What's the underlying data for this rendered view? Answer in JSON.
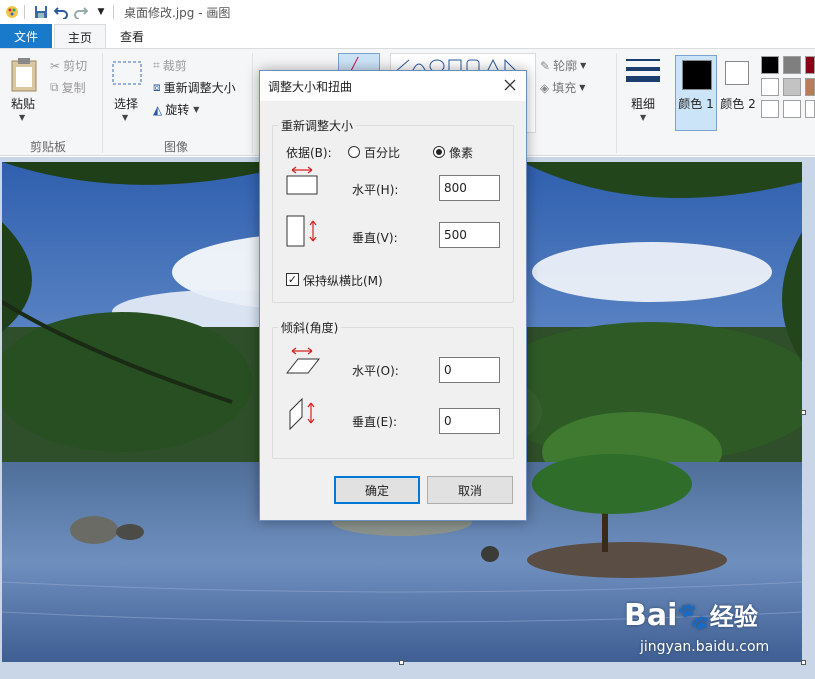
{
  "window": {
    "title": "桌面修改.jpg - 画图"
  },
  "tabs": {
    "file": "文件",
    "home": "主页",
    "view": "查看"
  },
  "ribbon": {
    "clipboard": {
      "paste": "粘贴",
      "cut": "剪切",
      "copy": "复制",
      "group": "剪贴板"
    },
    "image": {
      "select": "选择",
      "crop": "裁剪",
      "resize": "重新调整大小",
      "rotate": "旋转",
      "group": "图像"
    },
    "shapes": {
      "outline": "轮廓",
      "fill": "填充"
    },
    "size": "粗细",
    "color1": "颜色 1",
    "color2": "颜色 2",
    "palette": [
      "#000000",
      "#7f7f7f",
      "#880015",
      "#ffffff",
      "#c3c3c3",
      "#b97a57",
      "#ffffff",
      "#ffffff",
      "#ffffff"
    ]
  },
  "dialog": {
    "title": "调整大小和扭曲",
    "resize": {
      "legend": "重新调整大小",
      "by_label": "依据(B):",
      "percent": "百分比",
      "pixels": "像素",
      "horizontal_label": "水平(H):",
      "horizontal_value": "800",
      "vertical_label": "垂直(V):",
      "vertical_value": "500",
      "keep_ratio": "保持纵横比(M)"
    },
    "skew": {
      "legend": "倾斜(角度)",
      "horizontal_label": "水平(O):",
      "horizontal_value": "0",
      "vertical_label": "垂直(E):",
      "vertical_value": "0"
    },
    "ok": "确定",
    "cancel": "取消"
  },
  "watermark": {
    "brand": "Bai",
    "brand2": "经验",
    "url": "jingyan.baidu.com"
  }
}
